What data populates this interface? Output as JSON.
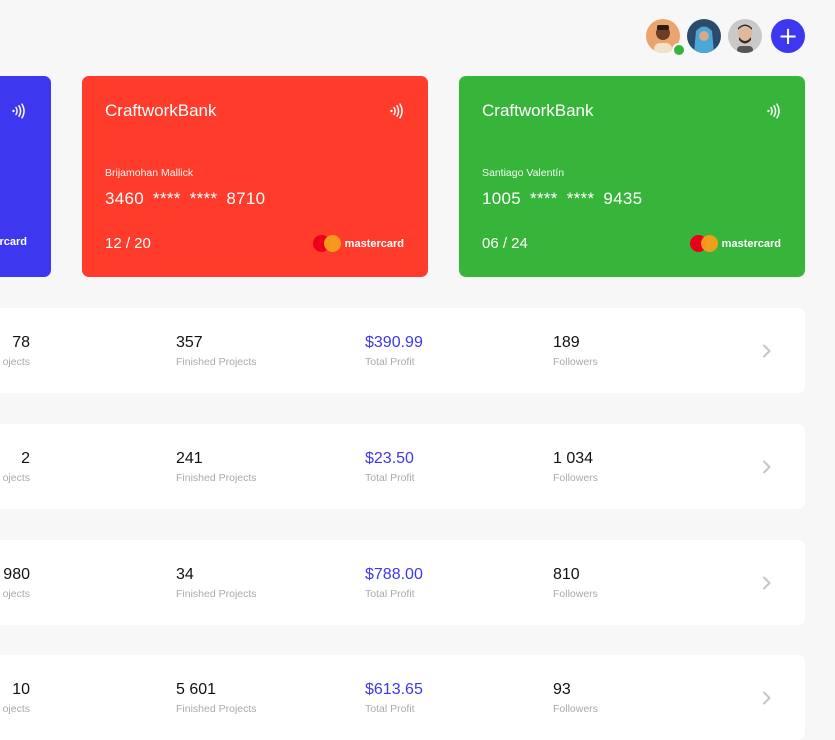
{
  "header": {
    "avatars": [
      {
        "name": "user-avatar-1",
        "online": true
      },
      {
        "name": "user-avatar-2",
        "online": false
      },
      {
        "name": "user-avatar-3",
        "online": false
      }
    ],
    "add_label": "+"
  },
  "cards": {
    "blue": {
      "brand_partial": "rcard",
      "color": "#3d37f0"
    },
    "red": {
      "bank": "CraftworkBank",
      "holder": "Brijamohan Mallick",
      "number": "3460 **** **** 8710",
      "expiry": "12 / 20",
      "brand": "mastercard",
      "color": "#ff3b2b"
    },
    "green": {
      "bank": "CraftworkBank",
      "holder": "Santiago Valentín",
      "number": "1005 **** **** 9435",
      "expiry": "06 / 24",
      "brand": "mastercard",
      "color": "#37b53a"
    }
  },
  "rows": [
    {
      "first_value": "78",
      "first_label": "ojects",
      "finished": "357",
      "finished_label": "Finished Projects",
      "profit": "$390.99",
      "profit_label": "Total Profit",
      "followers": "189",
      "followers_label": "Followers"
    },
    {
      "first_value": "2",
      "first_label": "ojects",
      "finished": "241",
      "finished_label": "Finished Projects",
      "profit": "$23.50",
      "profit_label": "Total Profit",
      "followers": "1 034",
      "followers_label": "Followers"
    },
    {
      "first_value": "980",
      "first_label": "ojects",
      "finished": "34",
      "finished_label": "Finished Projects",
      "profit": "$788.00",
      "profit_label": "Total Profit",
      "followers": "810",
      "followers_label": "Followers"
    },
    {
      "first_value": "10",
      "first_label": "ojects",
      "finished": "5 601",
      "finished_label": "Finished Projects",
      "profit": "$613.65",
      "profit_label": "Total Profit",
      "followers": "93",
      "followers_label": "Followers"
    }
  ],
  "colors": {
    "accent": "#3d37f0",
    "label_gray": "#a9a9b2",
    "online": "#33b53a"
  }
}
